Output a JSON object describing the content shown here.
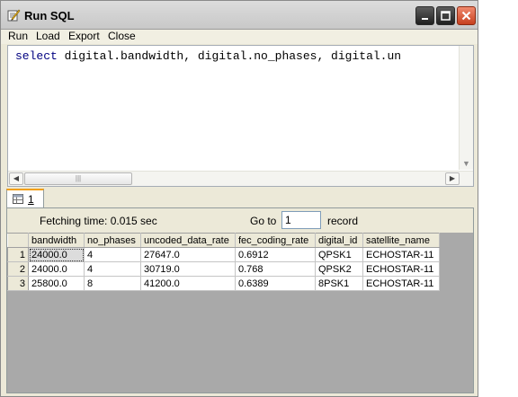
{
  "window": {
    "title": "Run SQL"
  },
  "titlebar_buttons": {
    "minimize_icon": "minimize-icon",
    "maximize_icon": "maximize-icon",
    "close_icon": "close-icon"
  },
  "menu": {
    "items": [
      "Run",
      "Load",
      "Export",
      "Close"
    ]
  },
  "editor": {
    "sql_keyword": "select",
    "sql_rest": " digital.bandwidth, digital.no_phases, digital.un"
  },
  "tab": {
    "label": "1",
    "icon": "table-icon"
  },
  "results": {
    "fetching_text": "Fetching time: 0.015 sec",
    "goto_label": "Go to",
    "goto_value": "1",
    "record_label": "record",
    "columns": [
      "bandwidth",
      "no_phases",
      "uncoded_data_rate",
      "fec_coding_rate",
      "digital_id",
      "satellite_name"
    ],
    "rows": [
      {
        "num": "1",
        "cells": [
          "24000.0",
          "4",
          "27647.0",
          "0.6912",
          "QPSK1",
          "ECHOSTAR-11"
        ]
      },
      {
        "num": "2",
        "cells": [
          "24000.0",
          "4",
          "30719.0",
          "0.768",
          "QPSK2",
          "ECHOSTAR-11"
        ]
      },
      {
        "num": "3",
        "cells": [
          "25800.0",
          "8",
          "41200.0",
          "0.6389",
          "8PSK1",
          "ECHOSTAR-11"
        ]
      }
    ]
  },
  "colors": {
    "close_button": "#d9532e",
    "tab_accent": "#f2a01a",
    "grid_background": "#a9a9a9"
  }
}
